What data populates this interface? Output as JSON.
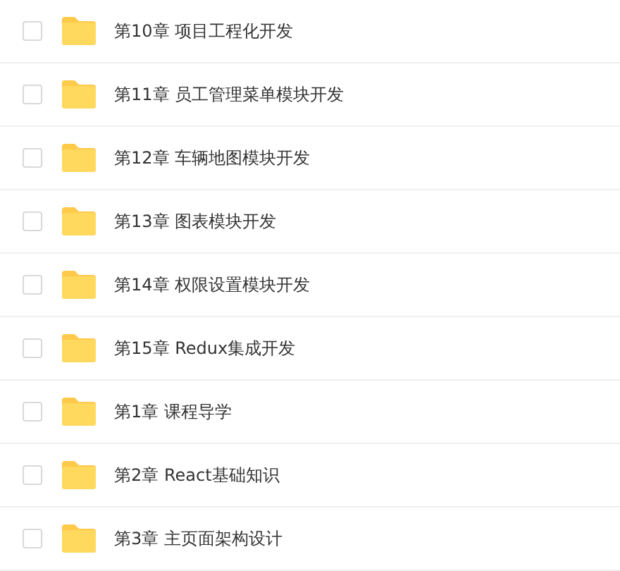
{
  "files": [
    {
      "name": "第10章 项目工程化开发",
      "checked": false
    },
    {
      "name": "第11章 员工管理菜单模块开发",
      "checked": false
    },
    {
      "name": "第12章 车辆地图模块开发",
      "checked": false
    },
    {
      "name": "第13章 图表模块开发",
      "checked": false
    },
    {
      "name": "第14章 权限设置模块开发",
      "checked": false
    },
    {
      "name": "第15章 Redux集成开发",
      "checked": false
    },
    {
      "name": "第1章 课程导学",
      "checked": false
    },
    {
      "name": "第2章 React基础知识",
      "checked": false
    },
    {
      "name": "第3章 主页面架构设计",
      "checked": false
    }
  ]
}
